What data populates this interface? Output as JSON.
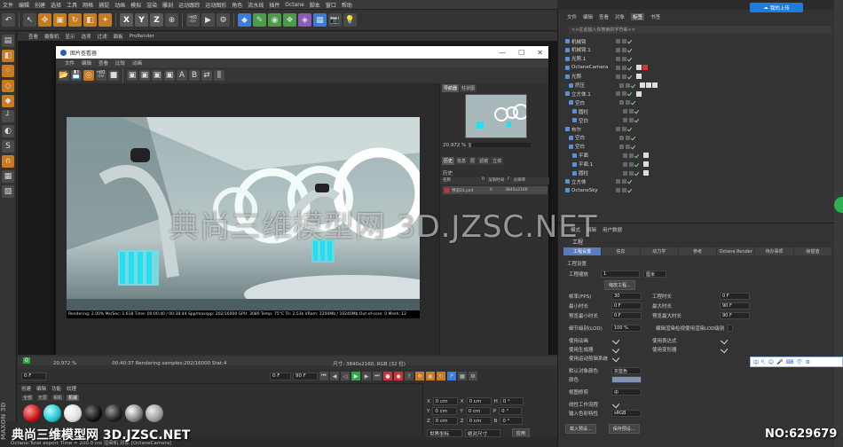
{
  "menubar": {
    "items": [
      "文件",
      "编辑",
      "创建",
      "选择",
      "工具",
      "网格",
      "捕捉",
      "动画",
      "模拟",
      "渲染",
      "雕刻",
      "运动跟踪",
      "运动图形",
      "角色",
      "流水线",
      "插件",
      "Octane",
      "脚本",
      "窗口",
      "帮助"
    ]
  },
  "toolbar": {
    "xyz": [
      "X",
      "Y",
      "Z"
    ]
  },
  "viewport": {
    "menu": [
      "查看",
      "摄像机",
      "显示",
      "选项",
      "过滤",
      "面板",
      "ProRender"
    ]
  },
  "picture_viewer": {
    "title": "图片查看器",
    "menu": [
      "文件",
      "编辑",
      "查看",
      "比较",
      "动画"
    ],
    "render_info": "Rendering: 2.00% Ms/Sec: 1.618  Time: 00:00:40 / 00:38:44  Spp/maxspp: 202/16000  GPU: 3080  Temp: 75°C  Tri: 2.53k  VRam: 2200Mb / 10240Mb  Out-of-core: 0  Mesh: 12",
    "nav_tabs": [
      "导航器",
      "柱状图"
    ],
    "zoom": "20.972 %",
    "zoom_fraction": 0.04,
    "hist_tabs": [
      "历史",
      "信息",
      "层",
      "滤镜",
      "立体"
    ],
    "hist_title": "历史",
    "hist_cols": [
      "名称",
      "R",
      "渲染时间",
      "F",
      "分辨率"
    ],
    "hist_row": {
      "name": "预览01.psd",
      "time": "0",
      "res": "3840x2160"
    }
  },
  "timeline": {
    "frame_left": "0",
    "zoom": "20.972 %",
    "status": "00:40:37 Rendering samples:202/16000 Stat:4",
    "size": "尺寸: 3840x2160, RGB (32 位)",
    "start": "0 F",
    "end": "90 F",
    "cur": "90 F",
    "f1": "0 F"
  },
  "material": {
    "menu": [
      "创建",
      "编辑",
      "功能",
      "纹理"
    ],
    "tabs": [
      "全部",
      "无层",
      "相机",
      "机械"
    ]
  },
  "coords": {
    "rows": [
      {
        "a": "X",
        "av": "0 cm",
        "b": "X",
        "bv": "0 cm",
        "c": "H",
        "cv": "0 °"
      },
      {
        "a": "Y",
        "av": "0 cm",
        "b": "Y",
        "bv": "0 cm",
        "c": "P",
        "cv": "0 °"
      },
      {
        "a": "Z",
        "av": "0 cm",
        "b": "Z",
        "bv": "0 cm",
        "c": "B",
        "cv": "0 °"
      }
    ],
    "sel1": "世界坐标",
    "sel2": "绝对尺寸",
    "apply": "应用"
  },
  "statusbar": {
    "text": "Octane:Total export Time = 200.0 ms     渲染机 对象 [OctaneCamera]"
  },
  "object_manager": {
    "menu": [
      "文件",
      "编辑",
      "查看",
      "对象",
      "标签",
      "书签"
    ],
    "active_tab": "标签",
    "search": "<<在此输入你搜索的字符串>>",
    "objects": [
      "机械臂",
      "机械臂.1",
      "光照.1",
      "OctaneCamera",
      "光照",
      "挤压",
      "立方体.1",
      "空白",
      "圆柱",
      "空白",
      "布尔",
      "空白",
      "空白",
      "平面",
      "平面.1",
      "圆柱",
      "立方体",
      "OctaneSky"
    ],
    "share": "我的上传"
  },
  "attributes": {
    "menu": [
      "模式",
      "编辑",
      "用户数据"
    ],
    "title": "工程",
    "tabs": [
      "工程设置",
      "信息",
      "动力学",
      "参考",
      "Octane Render",
      "待办事项",
      "帧插值"
    ],
    "sub": "工程设置",
    "scale_label": "工程缩放",
    "scale_val": "1",
    "scale_unit": "厘米",
    "scale_btn": "缩放工程...",
    "fps_label": "帧率(FPS)",
    "fps": "30",
    "time_label": "工程时长",
    "time": "0 F",
    "min_label": "最小时长",
    "min": "0 F",
    "max_label": "最大时长",
    "max": "90 F",
    "pmin_label": "预览最小时长",
    "pmin": "0 F",
    "pmax_label": "预览最大时长",
    "pmax": "90 F",
    "lod_label": "细节级别(LOD)",
    "lod": "100 %",
    "lod_render": "编辑渲染检视使用渲染LOD级别",
    "use_anim": "使用动画",
    "use_expr": "使用表达式",
    "use_gen": "使用生成器",
    "use_deform": "使用变形器",
    "use_motion": "使用运动剪辑系统",
    "default_obj": "默认对象颜色",
    "default_obj_val": "灰蓝色",
    "color_label": "颜色",
    "view_clip": "视图修剪",
    "view_clip_val": "中",
    "linear": "线性工作流程",
    "input_color": "输入色彩特性",
    "input_color_val": "sRGB",
    "load_btn": "载入预设...",
    "save_btn": "保存预设..."
  },
  "ime": {
    "items": [
      "中",
      "º,",
      "☺",
      "🎤",
      "⌨",
      "👕",
      "⚙"
    ]
  },
  "watermarks": {
    "center": "典尚三维模型网 3D.JZSC.NET",
    "bottom": "典尚三维模型网 3D.JZSC.NET",
    "no": "NO:629679",
    "maxon": "MAXON 3D"
  }
}
